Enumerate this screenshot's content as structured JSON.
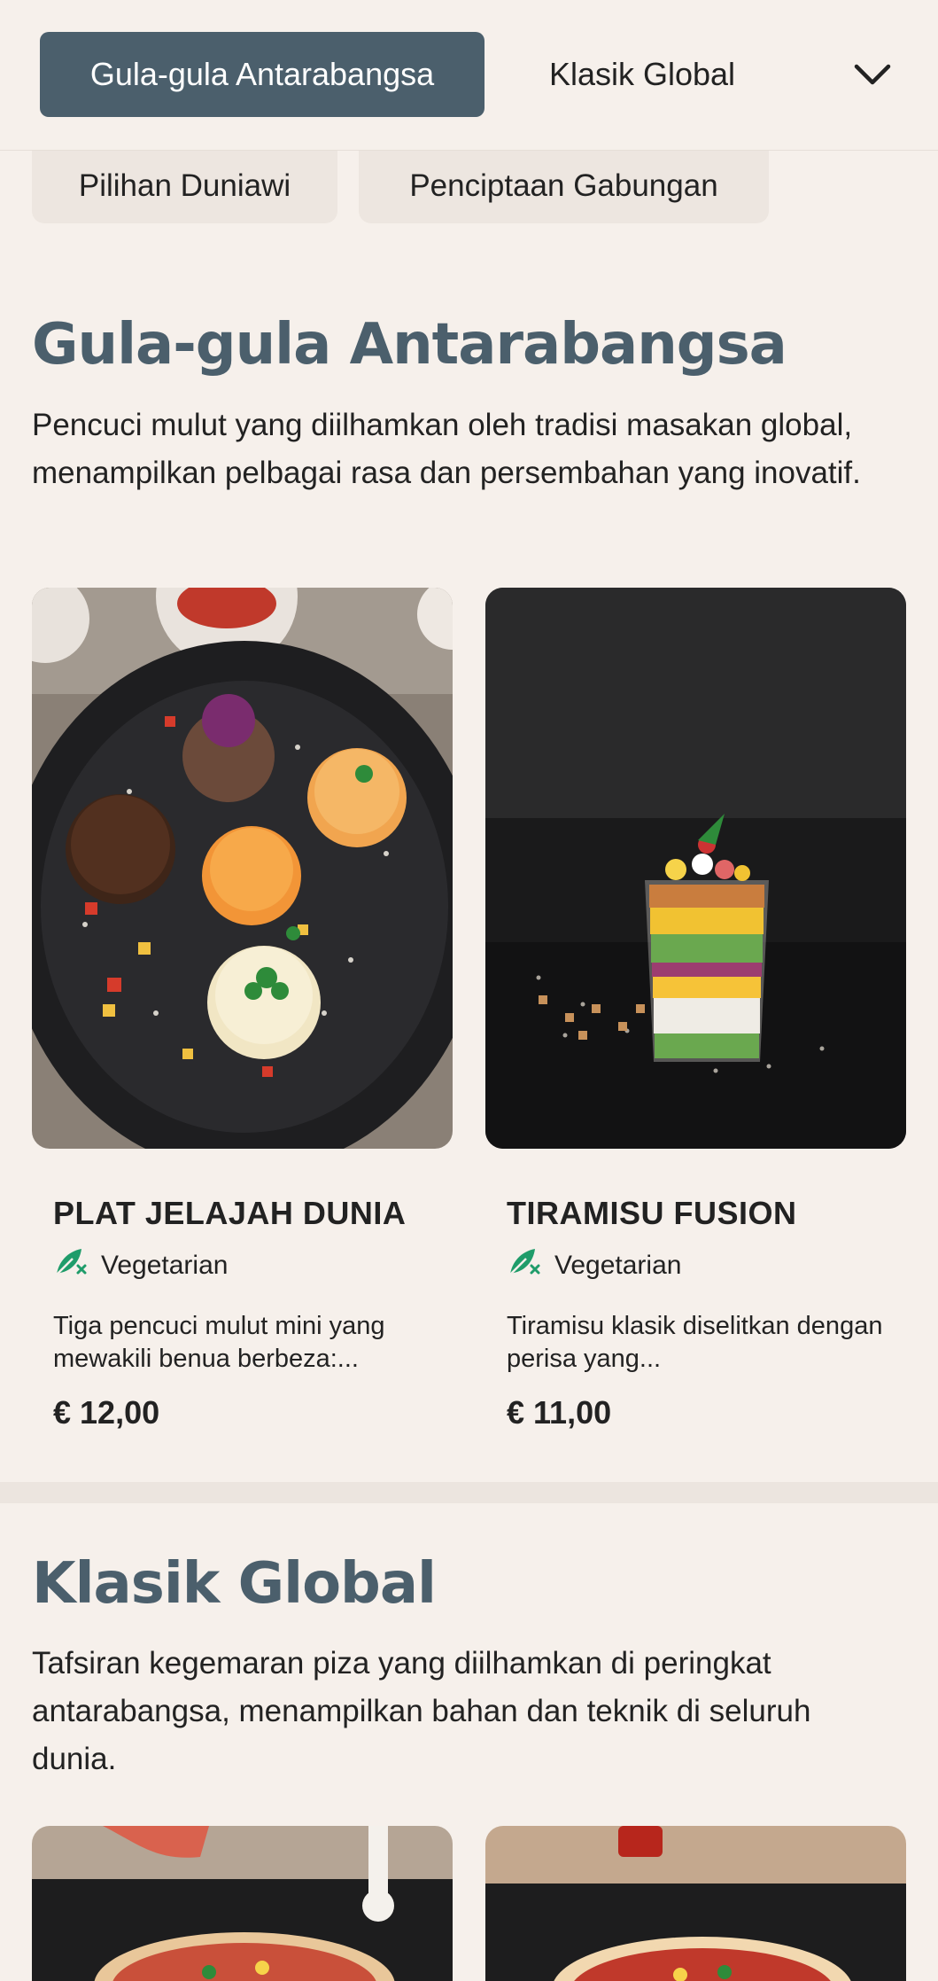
{
  "nav": {
    "tabs": [
      {
        "label": "Gula-gula Antarabangsa",
        "active": true
      },
      {
        "label": "Klasik Global",
        "active": false
      }
    ],
    "more_icon": "chevron-down-icon",
    "row2": [
      {
        "label": "Pilihan Duniawi"
      },
      {
        "label": "Penciptaan Gabungan"
      }
    ]
  },
  "sections": [
    {
      "title": "Gula-gula Antarabangsa",
      "description": "Pencuci mulut yang diilhamkan oleh tradisi masakan global, menampilkan pelbagai rasa dan persembahan yang inovatif.",
      "items": [
        {
          "name": "PLAT JELAJAH DUNIA",
          "tag": "Vegetarian",
          "tag_icon": "vegetarian-leaf-icon",
          "description": "Tiga pencuci mulut mini yang mewakili benua berbeza:...",
          "price": "€ 12,00"
        },
        {
          "name": "TIRAMISU FUSION",
          "tag": "Vegetarian",
          "tag_icon": "vegetarian-leaf-icon",
          "description": "Tiramisu klasik diselitkan dengan perisa yang...",
          "price": "€ 11,00"
        }
      ]
    },
    {
      "title": "Klasik Global",
      "description": "Tafsiran kegemaran piza yang diilhamkan di peringkat antarabangsa, menampilkan bahan dan teknik di seluruh dunia."
    }
  ],
  "colors": {
    "background": "#f6f0eb",
    "accent": "#4b5f6c",
    "veg_icon": "#1f9c6a"
  }
}
